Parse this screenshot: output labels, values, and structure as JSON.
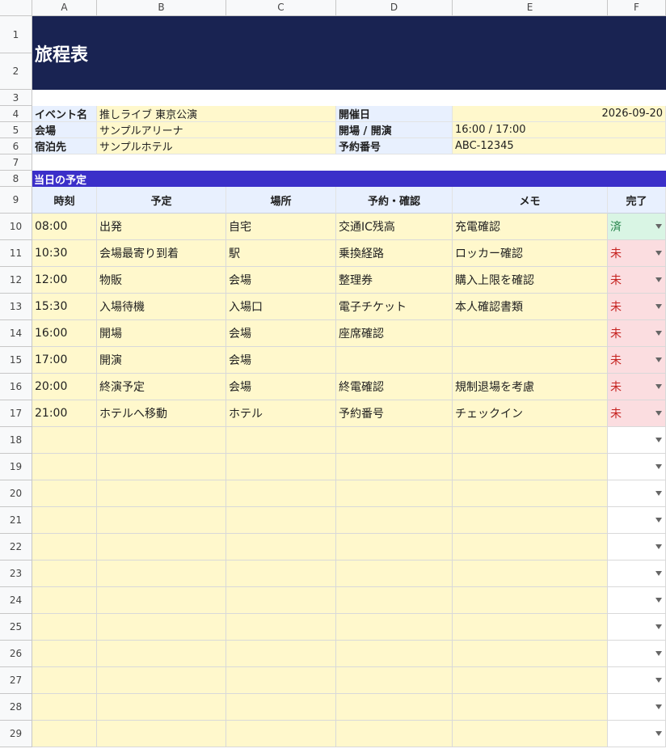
{
  "columns": [
    "A",
    "B",
    "C",
    "D",
    "E",
    "F"
  ],
  "row_numbers": [
    "1",
    "2",
    "3",
    "4",
    "5",
    "6",
    "7",
    "8",
    "9",
    "10",
    "11",
    "12",
    "13",
    "14",
    "15",
    "16",
    "17",
    "18",
    "19",
    "20",
    "21",
    "22",
    "23",
    "24",
    "25",
    "26",
    "27",
    "28",
    "29"
  ],
  "title": "旅程表",
  "info": {
    "event_label": "イベント名",
    "event_value": "推しライブ 東京公演",
    "date_label": "開催日",
    "date_value": "2026-09-20",
    "venue_label": "会場",
    "venue_value": "サンプルアリーナ",
    "open_label": "開場 / 開演",
    "open_value": "16:00 / 17:00",
    "hotel_label": "宿泊先",
    "hotel_value": "サンプルホテル",
    "booking_label": "予約番号",
    "booking_value": "ABC-12345"
  },
  "section_title": "当日の予定",
  "table": {
    "headers": [
      "時刻",
      "予定",
      "場所",
      "予約・確認",
      "メモ",
      "完了"
    ],
    "rows": [
      {
        "time": "08:00",
        "plan": "出発",
        "place": "自宅",
        "check": "交通IC残高",
        "memo": "充電確認",
        "status": "済"
      },
      {
        "time": "10:30",
        "plan": "会場最寄り到着",
        "place": "駅",
        "check": "乗換経路",
        "memo": "ロッカー確認",
        "status": "未"
      },
      {
        "time": "12:00",
        "plan": "物販",
        "place": "会場",
        "check": "整理券",
        "memo": "購入上限を確認",
        "status": "未"
      },
      {
        "time": "15:30",
        "plan": "入場待機",
        "place": "入場口",
        "check": "電子チケット",
        "memo": "本人確認書類",
        "status": "未"
      },
      {
        "time": "16:00",
        "plan": "開場",
        "place": "会場",
        "check": "座席確認",
        "memo": "",
        "status": "未"
      },
      {
        "time": "17:00",
        "plan": "開演",
        "place": "会場",
        "check": "",
        "memo": "",
        "status": "未"
      },
      {
        "time": "20:00",
        "plan": "終演予定",
        "place": "会場",
        "check": "終電確認",
        "memo": "規制退場を考慮",
        "status": "未"
      },
      {
        "time": "21:00",
        "plan": "ホテルへ移動",
        "place": "ホテル",
        "check": "予約番号",
        "memo": "チェックイン",
        "status": "未"
      }
    ],
    "empty_row_count": 12
  }
}
